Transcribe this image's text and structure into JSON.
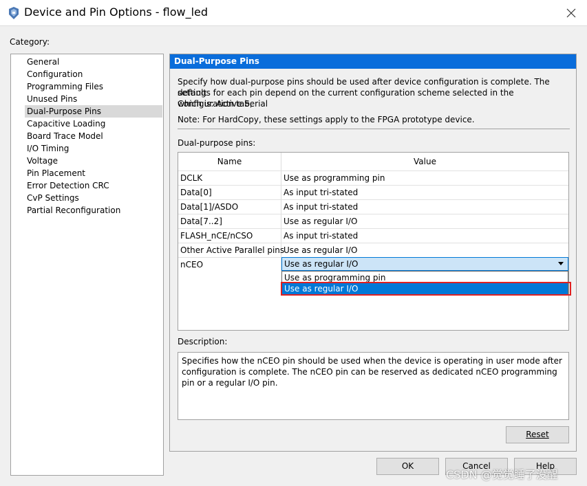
{
  "window": {
    "title": "Device and Pin Options - flow_led",
    "close_icon": "close-icon"
  },
  "category": {
    "label": "Category:",
    "items": [
      "General",
      "Configuration",
      "Programming Files",
      "Unused Pins",
      "Dual-Purpose Pins",
      "Capacitive Loading",
      "Board Trace Model",
      "I/O Timing",
      "Voltage",
      "Pin Placement",
      "Error Detection CRC",
      "CvP Settings",
      "Partial Reconfiguration"
    ],
    "selected": "Dual-Purpose Pins"
  },
  "panel": {
    "header": "Dual-Purpose Pins",
    "intro_line1": "Specify how dual-purpose pins should be used after device configuration is complete. The default",
    "intro_line2": "settings for each pin depend on the current configuration scheme selected in the Configuration tab,",
    "intro_line3": "which is:  Active Serial",
    "note": "Note: For HardCopy, these settings apply to the FPGA prototype device.",
    "pins_label": "Dual-purpose pins:",
    "table": {
      "headers": [
        "Name",
        "Value"
      ],
      "rows": [
        {
          "name": "DCLK",
          "value": "Use as programming pin"
        },
        {
          "name": "Data[0]",
          "value": "As input tri-stated"
        },
        {
          "name": "Data[1]/ASDO",
          "value": "As input tri-stated"
        },
        {
          "name": "Data[7..2]",
          "value": "Use as regular I/O"
        },
        {
          "name": "FLASH_nCE/nCSO",
          "value": "As input tri-stated"
        },
        {
          "name": "Other Active Parallel pins",
          "value": "Use as regular I/O"
        },
        {
          "name": "nCEO",
          "value": "Use as regular I/O"
        }
      ],
      "dropdown_options": [
        "Use as programming pin",
        "Use as regular I/O"
      ],
      "dropdown_selected": "Use as regular I/O"
    },
    "description_label": "Description:",
    "description": "Specifies how the nCEO pin should be used when the device is operating in user mode after configuration is complete. The nCEO pin can be reserved as dedicated nCEO programming pin or a regular I/O pin.",
    "reset_label": "Reset"
  },
  "footer": {
    "ok_label": "OK",
    "cancel_label": "Cancel",
    "help_label": "Help"
  },
  "watermark": "CSDN @觉觉睡了没醒",
  "colors": {
    "header_bg": "#0a6ddb",
    "selection_bg": "#0078d7",
    "highlight": "#e02020"
  }
}
